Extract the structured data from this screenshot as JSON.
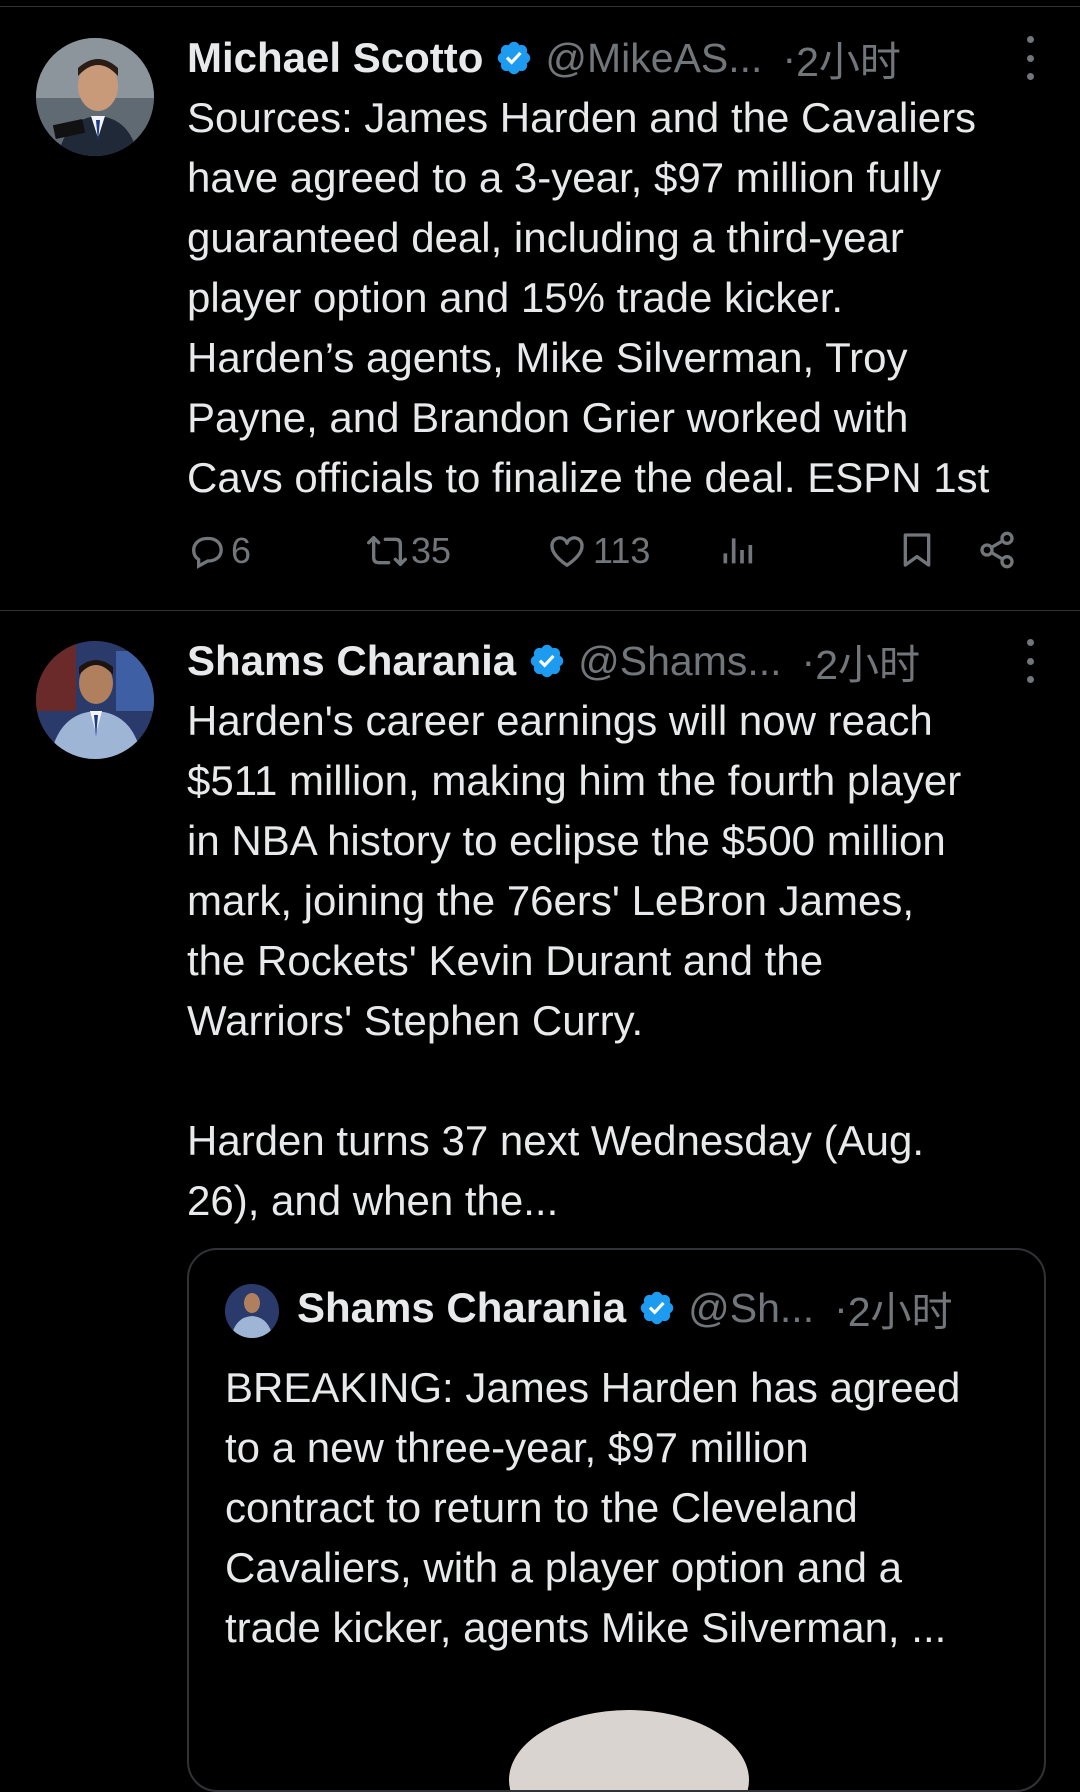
{
  "tweets": [
    {
      "name": "Michael Scotto",
      "handle": "@MikeAS...",
      "dot": "·",
      "time": "2小时",
      "text": "Sources: James Harden and the Cavaliers\nhave agreed to a 3-year, $97 million fully\nguaranteed deal, including a third-year\nplayer option and 15% trade kicker.\nHarden’s agents, Mike Silverman, Troy\nPayne, and Brandon Grier worked with\nCavs officials to finalize the deal. ESPN 1st",
      "replies": "6",
      "reposts": "35",
      "likes": "113"
    },
    {
      "name": "Shams Charania",
      "handle": "@Shams...",
      "dot": "·",
      "time": "2小时",
      "text": "Harden's career earnings will now reach\n$511 million, making him the fourth player\nin NBA history to eclipse the $500 million\nmark, joining the 76ers' LeBron James,\nthe Rockets' Kevin Durant and the\nWarriors' Stephen Curry.\n\nHarden turns 37 next Wednesday (Aug.\n26), and when the...",
      "quote": {
        "name": "Shams Charania",
        "handle": "@Sh...",
        "dot": "·",
        "time": "2小时",
        "text": "BREAKING: James Harden has agreed\nto a new three-year, $97 million\ncontract to return to the Cleveland\nCavaliers, with a player option and a\ntrade kicker, agents Mike Silverman, ..."
      }
    }
  ],
  "icons": {
    "verified": "verified-badge-icon",
    "more": "more-dots-icon",
    "reply": "reply-icon",
    "repost": "repost-icon",
    "like": "heart-icon",
    "views": "views-icon",
    "bookmark": "bookmark-icon",
    "share": "share-icon"
  },
  "colors": {
    "background": "#000000",
    "text": "#e7e9ea",
    "muted": "#71767b",
    "verified": "#1d9bf0",
    "divider": "#2f3336"
  }
}
